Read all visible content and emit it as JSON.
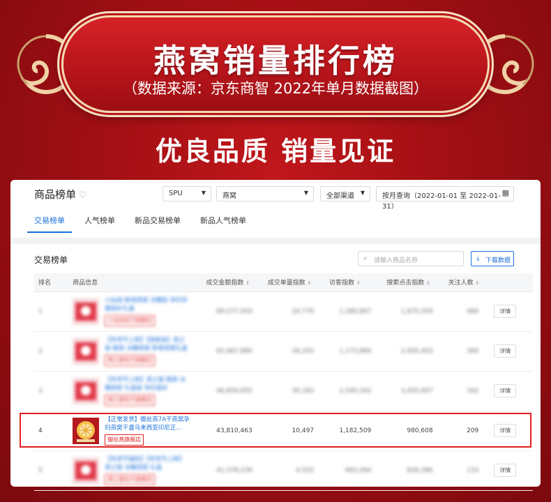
{
  "banner": {
    "title": "燕窝销量排行榜",
    "subtitle": "（数据来源：京东商智 2022年单月数据截图）"
  },
  "slogan": "优良品质 销量见证",
  "panel": {
    "page_title": "商品榜单",
    "filters": {
      "dim": "SPU",
      "category": "燕窝",
      "channel": "全部渠道",
      "date": "按月查询（2022-01-01 至 2022-01-31）"
    },
    "tabs": [
      "交易榜单",
      "人气榜单",
      "新品交易榜单",
      "新品人气榜单"
    ],
    "section_title": "交易榜单",
    "search_placeholder": "请输入商品名称",
    "download_label": "下载数据",
    "columns": [
      "排名",
      "商品信息",
      "成交金额指数",
      "成交单量指数",
      "访客指数",
      "搜索点击指数",
      "关注人数",
      ""
    ],
    "rows": [
      {
        "rank": "1",
        "name": "小仙炖 鲜炖燕窝 冰糖款 孕妇孕期滋补礼盒",
        "store": "小仙炖官方旗舰店",
        "amount": "89,277,554",
        "orders": "24,779",
        "visitors": "1,280,667",
        "clicks": "1,875,559",
        "follows": "484",
        "detail": "详情",
        "blurred": true
      },
      {
        "rank": "2",
        "name": "【年货节上新】【尝鲜装】燕之屋 碗燕 冰糖燕窝 即食燕窝礼盒",
        "store": "燕之屋官方旗舰店",
        "amount": "65,967,880",
        "orders": "28,255",
        "visitors": "1,173,869",
        "clicks": "2,005,403",
        "follows": "369",
        "detail": "详情",
        "blurred": true
      },
      {
        "rank": "3",
        "name": "【年货节上新】燕之屋 碗燕 冰糖燕窝 礼盒装 孕妇滋补",
        "store": "燕之屋官方旗舰店",
        "amount": "46,854,655",
        "orders": "30,183",
        "visitors": "2,540,342",
        "clicks": "3,455,697",
        "follows": "342",
        "detail": "详情",
        "blurred": true
      },
      {
        "rank": "4",
        "name": "【正常发货】御丝燕7A干燕窝孕妇燕窝干盏马来西亚印尼正...",
        "store": "御丝燕旗舰店",
        "amount": "43,810,463",
        "orders": "10,497",
        "visitors": "1,182,509",
        "clicks": "980,608",
        "follows": "209",
        "detail": "详情",
        "blurred": false
      },
      {
        "rank": "5",
        "name": "【年货节福利】【年货节上新】燕之屋 冰糖燕窝 礼盒",
        "store": "燕之屋官方旗舰店",
        "amount": "41,378,239",
        "orders": "4,532",
        "visitors": "665,264",
        "clicks": "828,386",
        "follows": "133",
        "detail": "详情",
        "blurred": true
      }
    ]
  }
}
